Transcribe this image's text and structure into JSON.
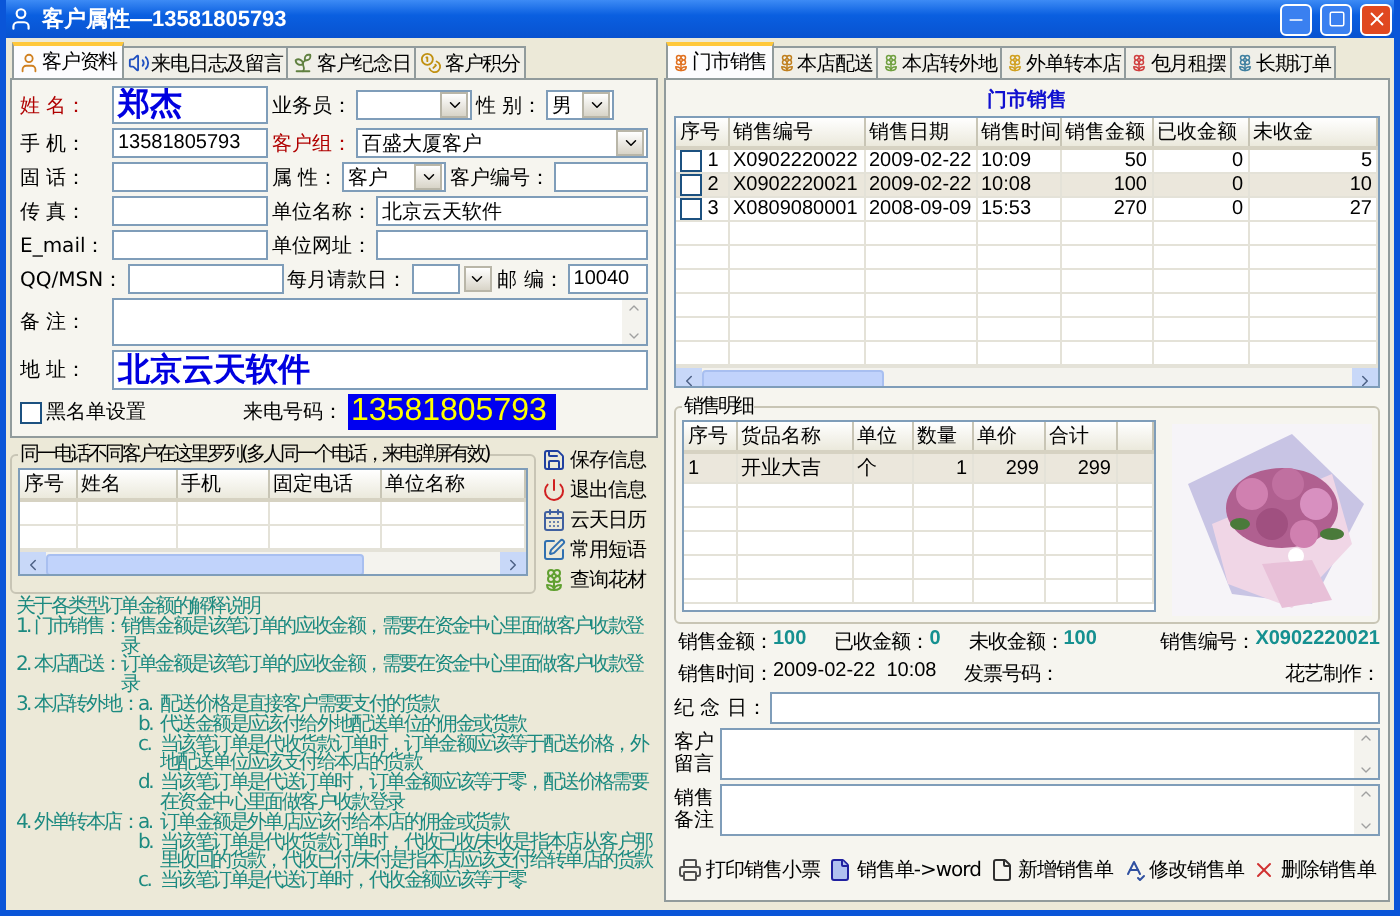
{
  "window": {
    "title": "客户属性—13581805793"
  },
  "left_tabs": [
    {
      "label": "客户资料",
      "selected": true
    },
    {
      "label": "来电日志及留言",
      "selected": false
    },
    {
      "label": "客户纪念日",
      "selected": false
    },
    {
      "label": "客户积分",
      "selected": false
    }
  ],
  "customer_form": {
    "name": {
      "label": "姓 名：",
      "value": "郑杰",
      "required": true
    },
    "salesperson": {
      "label": "业务员：",
      "required": false
    },
    "gender": {
      "label": "性 别：",
      "value": "男",
      "required": false
    },
    "mobile": {
      "label": "手 机：",
      "value": "13581805793",
      "required": false
    },
    "customer_group": {
      "label": "客户组：",
      "value": "百盛大厦客户",
      "required": true
    },
    "landline": {
      "label": "固 话：",
      "required": false
    },
    "attribute": {
      "label": "属 性：",
      "value": "客户",
      "required": false
    },
    "customer_no": {
      "label": "客户编号：",
      "required": false
    },
    "fax": {
      "label": "传 真：",
      "required": false
    },
    "company": {
      "label": "单位名称：",
      "value": "北京云天软件",
      "required": false
    },
    "email": {
      "label": "E_mail：",
      "required": false
    },
    "website": {
      "label": "单位网址：",
      "required": false
    },
    "qq_msn": {
      "label": "QQ/MSN：",
      "required": false
    },
    "billing_day": {
      "label": "每月请款日：",
      "required": false
    },
    "postcode": {
      "label": "邮 编：",
      "value": "10040",
      "required": false
    },
    "notes": {
      "label": "备 注：",
      "required": false
    },
    "address": {
      "label": "地 址：",
      "value": "北京云天软件",
      "required": false
    },
    "blacklist": {
      "label": "黑名单设置",
      "checked": false
    },
    "caller_number": {
      "label": "来电号码：",
      "value": "13581805793"
    }
  },
  "same_phone_list": {
    "title": "同一电话不同客户在这里罗列(多人同一个电话，来电弹屏有效)",
    "columns": [
      "序号",
      "姓名",
      "手机",
      "固定电话",
      "单位名称"
    ]
  },
  "side_actions": [
    "保存信息",
    "退出信息",
    "云天日历",
    "常用短语",
    "查询花材"
  ],
  "explanation": {
    "title": "关于各类型订单金额的解释说明",
    "sections": [
      {
        "heading": "1. 门市销售：",
        "items": [
          {
            "text": "销售金额是该笔订单的应收金额，需要在资金中心里面做客户收款登录"
          }
        ]
      },
      {
        "heading": "2. 本店配送：",
        "items": [
          {
            "text": "订单金额是该笔订单的应收金额，需要在资金中心里面做客户收款登录"
          }
        ]
      },
      {
        "heading": "3. 本店转外地：",
        "items": [
          {
            "marker": "a.",
            "text": "配送价格是直接客户需要支付的货款"
          },
          {
            "marker": "b.",
            "text": "代送金额是应该付给外地配送单位的佣金或货款"
          },
          {
            "marker": "c.",
            "text": "当该笔订单是代收货款订单时，订单金额应该等于配送价格，外地配送单位应该支付给本店的货款"
          },
          {
            "marker": "d.",
            "text": "当该笔订单是代送订单时，订单金额应该等于零，配送价格需要在资金中心里面做客户收款登录"
          }
        ]
      },
      {
        "heading": "4. 外单转本店：",
        "items": [
          {
            "marker": "a.",
            "text": "订单金额是外单店应该付给本店的佣金或货款"
          },
          {
            "marker": "b.",
            "text": "当该笔订单是代收货款订单时，代收已收/未收是指本店从客户那里收回的货款，代收已付/未付是指本店应该支付给转单店的货款"
          },
          {
            "marker": "c.",
            "text": "当该笔订单是代送订单时，代收金额应该等于零"
          }
        ]
      }
    ]
  },
  "right_tabs": [
    {
      "label": "门市销售",
      "selected": true
    },
    {
      "label": "本店配送",
      "selected": false
    },
    {
      "label": "本店转外地",
      "selected": false
    },
    {
      "label": "外单转本店",
      "selected": false
    },
    {
      "label": "包月租摆",
      "selected": false
    },
    {
      "label": "长期订单",
      "selected": false
    }
  ],
  "sales_title": "门市销售",
  "sales_table": {
    "columns": [
      "序号",
      "销售编号",
      "销售日期",
      "销售时间",
      "销售金额",
      "已收金额",
      "未收金"
    ],
    "rows": [
      {
        "checked": false,
        "selected": false,
        "cells": [
          "1",
          "X0902220022",
          "2009-02-22",
          "10:09",
          "50",
          "0",
          "5"
        ]
      },
      {
        "checked": false,
        "selected": true,
        "cells": [
          "2",
          "X0902220021",
          "2009-02-22",
          "10:08",
          "100",
          "0",
          "10"
        ]
      },
      {
        "checked": false,
        "selected": false,
        "cells": [
          "3",
          "X0809080001",
          "2008-09-09",
          "15:53",
          "270",
          "0",
          "27"
        ]
      }
    ]
  },
  "sales_detail": {
    "title": "销售明细",
    "columns": [
      "序号",
      "货品名称",
      "单位",
      "数量",
      "单价",
      "合计"
    ],
    "rows": [
      {
        "selected": true,
        "cells": [
          "1",
          "开业大吉",
          "个",
          "1",
          "299",
          "299"
        ]
      }
    ]
  },
  "summary_rows": [
    {
      "items": [
        {
          "label": "销售金额：",
          "value": "100",
          "emphasis": true
        },
        {
          "label": "已收金额：",
          "value": "0",
          "emphasis": true
        },
        {
          "label": "未收金额：",
          "value": "100",
          "emphasis": true
        },
        {
          "label": "销售编号：",
          "value": "X0902220021",
          "emphasis": true
        }
      ]
    },
    {
      "items": [
        {
          "label": "销售时间：",
          "value": "2009-02-22  10:08",
          "emphasis": false
        },
        {
          "label": "发票号码："
        },
        {
          "label": "花艺制作："
        }
      ]
    }
  ],
  "anniversary": {
    "label": "纪 念 日："
  },
  "customer_message": {
    "label": "客户留言"
  },
  "sales_notes": {
    "label": "销售备注"
  },
  "actions": [
    "打印销售小票",
    "销售单->word",
    "新增销售单",
    "修改销售单",
    "删除销售单"
  ]
}
